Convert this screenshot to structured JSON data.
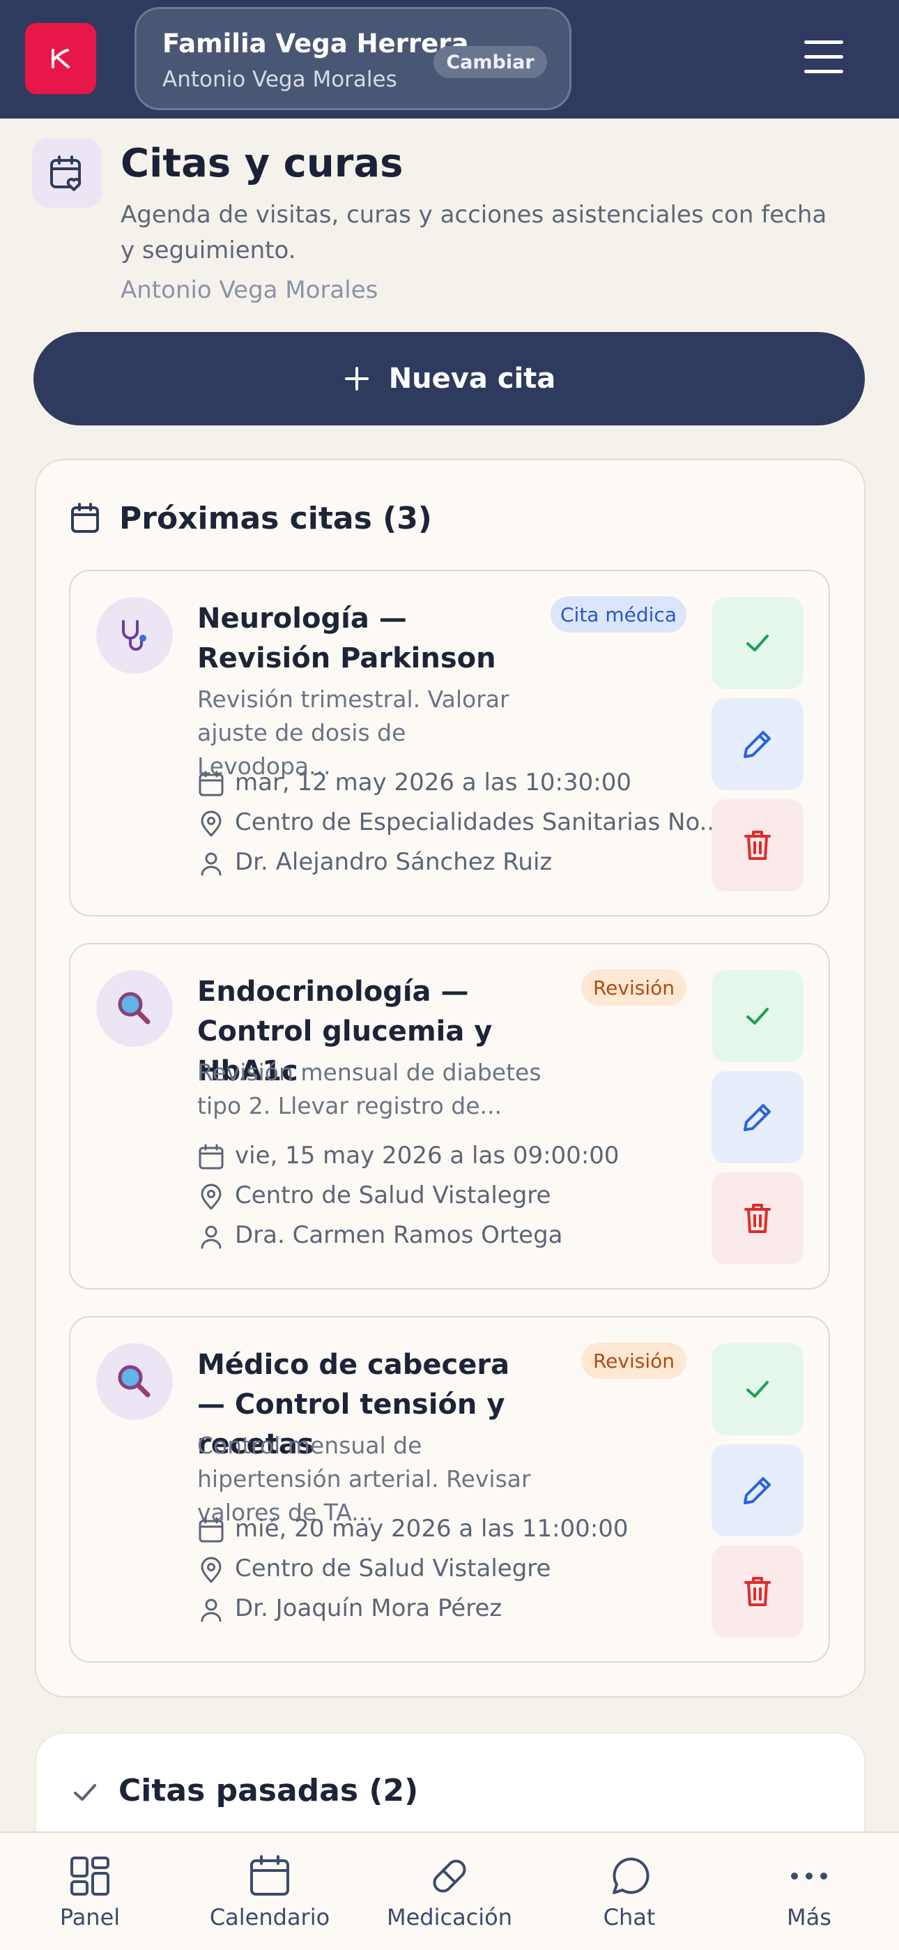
{
  "header": {
    "family_name": "Familia Vega Herrera",
    "patient_name": "Antonio Vega Morales",
    "change_label": "Cambiar",
    "logo_icon": "heart-hand-logo",
    "menu_icon": "hamburger-menu-icon"
  },
  "page": {
    "title": "Citas y curas",
    "description": "Agenda de visitas, curas y acciones asistenciales con fecha y seguimiento.",
    "patient": "Antonio Vega Morales",
    "new_button_label": "Nueva cita"
  },
  "upcoming": {
    "title": "Próximas citas (3)",
    "items": [
      {
        "title": "Neurología — Revisión Parkinson",
        "badge": "Cita médica",
        "badge_color": "blue",
        "icon": "stethoscope-icon",
        "description": "Revisión trimestral. Valorar ajuste de dosis de Levodopa...",
        "date": "mar, 12 may 2026 a las 10:30:00",
        "location": "Centro de Especialidades Sanitarias No...",
        "doctor": "Dr. Alejandro Sánchez Ruiz"
      },
      {
        "title": "Endocrinología — Control glucemia y HbA1c",
        "badge": "Revisión",
        "badge_color": "orange",
        "icon": "magnifier-icon",
        "description": "Revisión mensual de diabetes tipo 2. Llevar registro de...",
        "date": "vie, 15 may 2026 a las 09:00:00",
        "location": "Centro de Salud Vistalegre",
        "doctor": "Dra. Carmen Ramos Ortega"
      },
      {
        "title": "Médico de cabecera — Control tensión y recetas",
        "badge": "Revisión",
        "badge_color": "orange",
        "icon": "magnifier-icon",
        "description": "Control mensual de hipertensión arterial. Revisar valores de TA...",
        "date": "mié, 20 may 2026 a las 11:00:00",
        "location": "Centro de Salud Vistalegre",
        "doctor": "Dr. Joaquín Mora Pérez"
      }
    ]
  },
  "past": {
    "title": "Citas pasadas (2)"
  },
  "nav": {
    "items": [
      {
        "label": "Panel",
        "icon": "grid-icon"
      },
      {
        "label": "Calendario",
        "icon": "calendar-icon"
      },
      {
        "label": "Medicación",
        "icon": "pill-icon"
      },
      {
        "label": "Chat",
        "icon": "chat-bubble-icon"
      },
      {
        "label": "Más",
        "icon": "more-dots-icon"
      }
    ]
  },
  "colors": {
    "navy": "#2e3b5e",
    "brand_red": "#e8174a",
    "success_green": "#1f9d55",
    "edit_blue": "#2b63d9",
    "delete_red": "#e02b2b"
  }
}
